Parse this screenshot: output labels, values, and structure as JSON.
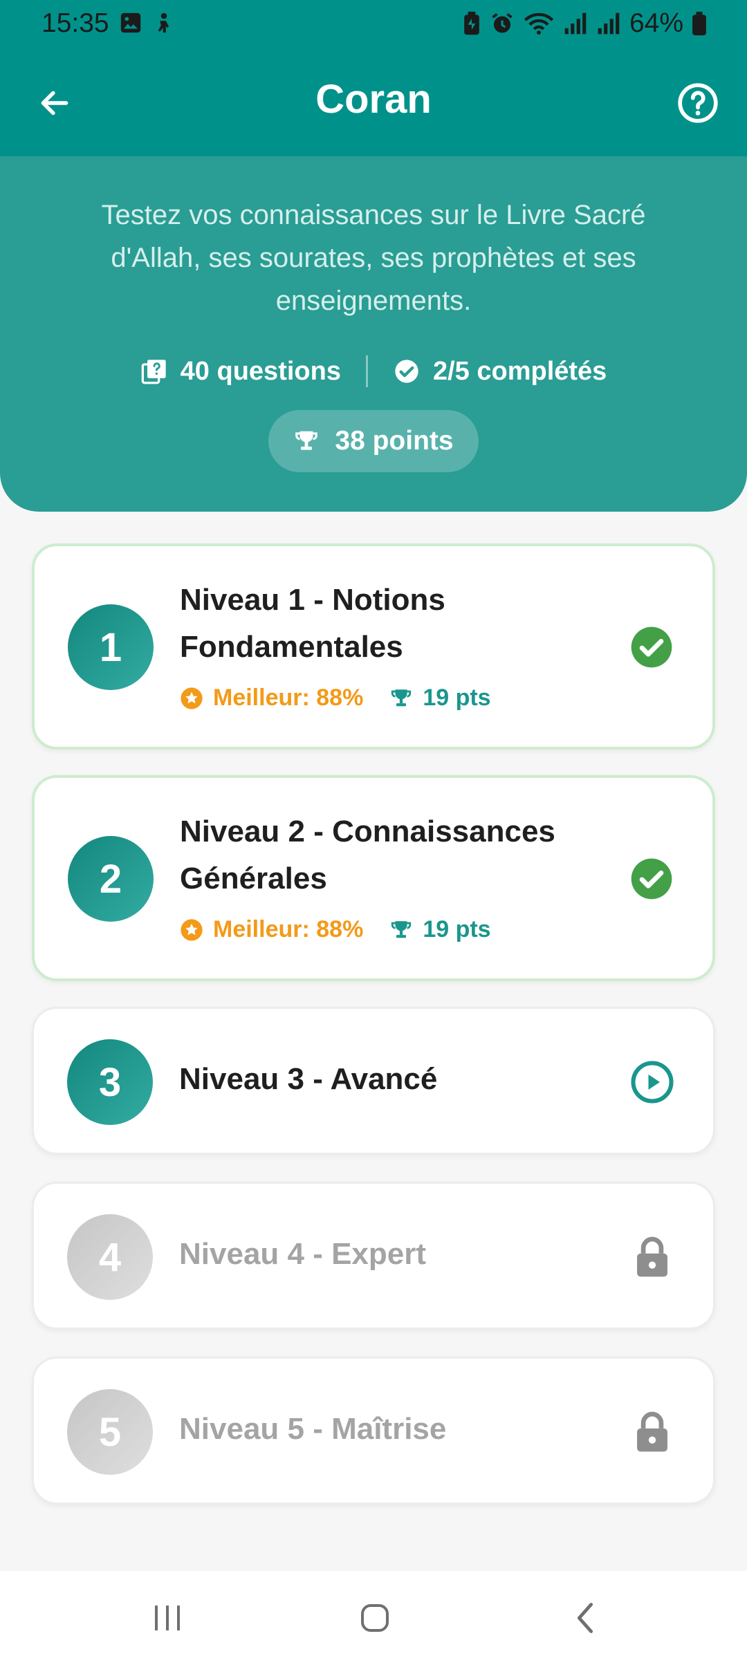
{
  "status_bar": {
    "time": "15:35",
    "battery": "64%"
  },
  "appbar": {
    "title": "Coran",
    "back_icon": "arrow-back-icon",
    "help_icon": "help-circle-icon"
  },
  "hero": {
    "description": "Testez vos connaissances sur le Livre Sacré d'Allah, ses sourates, ses prophètes et ses enseignements.",
    "questions": "40 questions",
    "completed": "2/5 complétés",
    "points": "38 points"
  },
  "levels": [
    {
      "number": "1",
      "title_line1": "Niveau 1 - Notions",
      "title_line2": "Fondamentales",
      "best": "Meilleur: 88%",
      "points": "19 pts",
      "status": "completed"
    },
    {
      "number": "2",
      "title_line1": "Niveau 2 - Connaissances",
      "title_line2": "Générales",
      "best": "Meilleur: 88%",
      "points": "19 pts",
      "status": "completed"
    },
    {
      "number": "3",
      "title": "Niveau 3 - Avancé",
      "status": "available"
    },
    {
      "number": "4",
      "title": "Niveau 4 - Expert",
      "status": "locked"
    },
    {
      "number": "5",
      "title": "Niveau 5 - Maîtrise",
      "status": "locked"
    }
  ],
  "colors": {
    "primary": "#00928a",
    "hero": "#2a9d94",
    "accent_orange": "#f39a18",
    "success_green": "#43a047",
    "locked_gray": "#a4a4a4"
  }
}
